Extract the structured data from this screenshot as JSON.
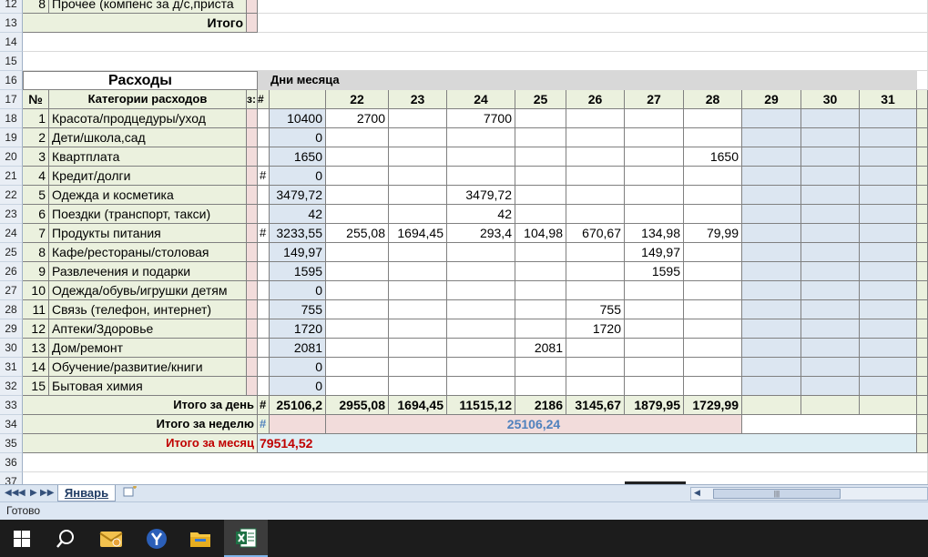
{
  "sheet": {
    "partial_row_12_label": "Прочее (компенс за д/с,приста",
    "partial_row_12_num": "8",
    "row13_label": "Итого",
    "section_title": "Расходы",
    "days_header": "Дни месяца",
    "col_no": "№",
    "col_category": "Категории расходов",
    "col_narrow": "з:",
    "col_hash": "#",
    "days": [
      "22",
      "23",
      "24",
      "25",
      "26",
      "27",
      "28",
      "29",
      "30",
      "31"
    ],
    "rows": [
      {
        "n": "1",
        "name": "Красота/продцедуры/уход",
        "hash": "",
        "total": "10400",
        "d": [
          "2700",
          "",
          "7700",
          "",
          "",
          "",
          "",
          "",
          "",
          ""
        ]
      },
      {
        "n": "2",
        "name": "Дети/школа,сад",
        "hash": "",
        "total": "0",
        "d": [
          "",
          "",
          "",
          "",
          "",
          "",
          "",
          "",
          "",
          ""
        ]
      },
      {
        "n": "3",
        "name": "Квартплата",
        "hash": "",
        "total": "1650",
        "d": [
          "",
          "",
          "",
          "",
          "",
          "",
          "1650",
          "",
          "",
          ""
        ]
      },
      {
        "n": "4",
        "name": "Кредит/долги",
        "hash": "#",
        "total": "0",
        "d": [
          "",
          "",
          "",
          "",
          "",
          "",
          "",
          "",
          "",
          ""
        ]
      },
      {
        "n": "5",
        "name": "Одежда и косметика",
        "hash": "",
        "total": "3479,72",
        "d": [
          "",
          "",
          "3479,72",
          "",
          "",
          "",
          "",
          "",
          "",
          ""
        ]
      },
      {
        "n": "6",
        "name": "Поездки (транспорт, такси)",
        "hash": "",
        "total": "42",
        "d": [
          "",
          "",
          "42",
          "",
          "",
          "",
          "",
          "",
          "",
          ""
        ]
      },
      {
        "n": "7",
        "name": "Продукты питания",
        "hash": "#",
        "total": "3233,55",
        "d": [
          "255,08",
          "1694,45",
          "293,4",
          "104,98",
          "670,67",
          "134,98",
          "79,99",
          "",
          "",
          ""
        ]
      },
      {
        "n": "8",
        "name": "Кафе/рестораны/столовая",
        "hash": "",
        "total": "149,97",
        "d": [
          "",
          "",
          "",
          "",
          "",
          "149,97",
          "",
          "",
          "",
          ""
        ]
      },
      {
        "n": "9",
        "name": "Развлечения и подарки",
        "hash": "",
        "total": "1595",
        "d": [
          "",
          "",
          "",
          "",
          "",
          "1595",
          "",
          "",
          "",
          ""
        ]
      },
      {
        "n": "10",
        "name": "Одежда/обувь/игрушки детям",
        "hash": "",
        "total": "0",
        "d": [
          "",
          "",
          "",
          "",
          "",
          "",
          "",
          "",
          "",
          ""
        ]
      },
      {
        "n": "11",
        "name": "Связь (телефон, интернет)",
        "hash": "",
        "total": "755",
        "d": [
          "",
          "",
          "",
          "",
          "755",
          "",
          "",
          "",
          "",
          ""
        ]
      },
      {
        "n": "12",
        "name": "Аптеки/Здоровье",
        "hash": "",
        "total": "1720",
        "d": [
          "",
          "",
          "",
          "",
          "1720",
          "",
          "",
          "",
          "",
          ""
        ]
      },
      {
        "n": "13",
        "name": "Дом/ремонт",
        "hash": "",
        "total": "2081",
        "d": [
          "",
          "",
          "",
          "2081",
          "",
          "",
          "",
          "",
          "",
          ""
        ]
      },
      {
        "n": "14",
        "name": "Обучение/развитие/книги",
        "hash": "",
        "total": "0",
        "d": [
          "",
          "",
          "",
          "",
          "",
          "",
          "",
          "",
          "",
          ""
        ]
      },
      {
        "n": "15",
        "name": "Бытовая химия",
        "hash": "",
        "total": "0",
        "d": [
          "",
          "",
          "",
          "",
          "",
          "",
          "",
          "",
          "",
          ""
        ]
      }
    ],
    "day_total_label": "Итого за день",
    "day_total_hash": "#",
    "day_total_sum": "25106,2",
    "day_totals": [
      "2955,08",
      "1694,45",
      "11515,12",
      "2186",
      "3145,67",
      "1879,95",
      "1729,99",
      "",
      "",
      ""
    ],
    "week_total_label": "Итого за неделю",
    "week_total_hash": "#",
    "week_total_value": "25106,24",
    "month_total_label": "Итого за месяц",
    "month_total_value": "79514,52",
    "row_numbers": [
      "12",
      "13",
      "14",
      "15",
      "16",
      "17",
      "18",
      "19",
      "20",
      "21",
      "22",
      "23",
      "24",
      "25",
      "26",
      "27",
      "28",
      "29",
      "30",
      "31",
      "32",
      "33",
      "34",
      "35",
      "36",
      "37"
    ]
  },
  "tabs": {
    "active": "Январь",
    "nav": [
      "◀◀",
      "◀",
      "▶",
      "▶▶"
    ]
  },
  "status": {
    "text": "Готово"
  },
  "taskbar": {
    "items": [
      "windows-start",
      "search",
      "mail",
      "yandex-browser",
      "file-explorer",
      "excel"
    ]
  },
  "colors": {
    "label_green": "#ebf1de",
    "pink": "#f2dcdb",
    "blue": "#dce6f1",
    "header_gray": "#d8d8d8",
    "week_total_blue": "#4f81bd",
    "month_total_red": "#c00000"
  }
}
